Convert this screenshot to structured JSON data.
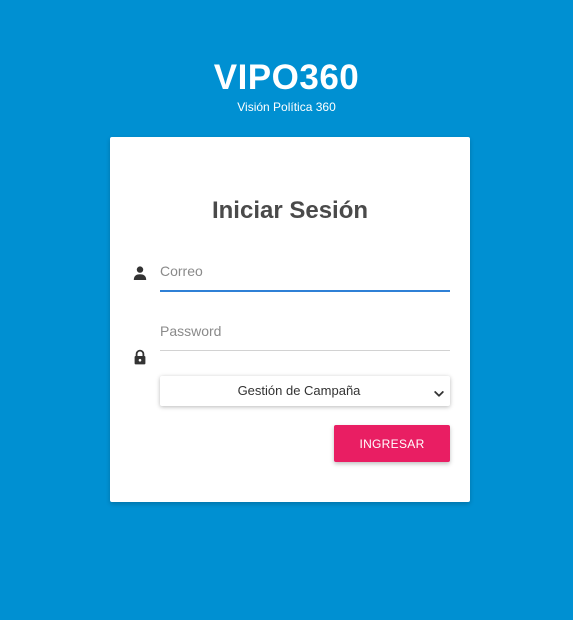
{
  "brand": {
    "title": "VIPO360",
    "subtitle": "Visión Política 360"
  },
  "login": {
    "title": "Iniciar Sesión",
    "email": {
      "value": "",
      "placeholder": "Correo",
      "icon": "person-icon"
    },
    "password": {
      "value": "",
      "placeholder": "Password",
      "icon": "lock-icon"
    },
    "mode_select": {
      "selected": "Gestión de Campaña"
    },
    "submit_label": "INGRESAR"
  },
  "colors": {
    "background": "#0090d2",
    "card": "#ffffff",
    "accent_button": "#e91e63",
    "focus_underline": "#2f80d6",
    "title_text": "#4a4a4a"
  }
}
